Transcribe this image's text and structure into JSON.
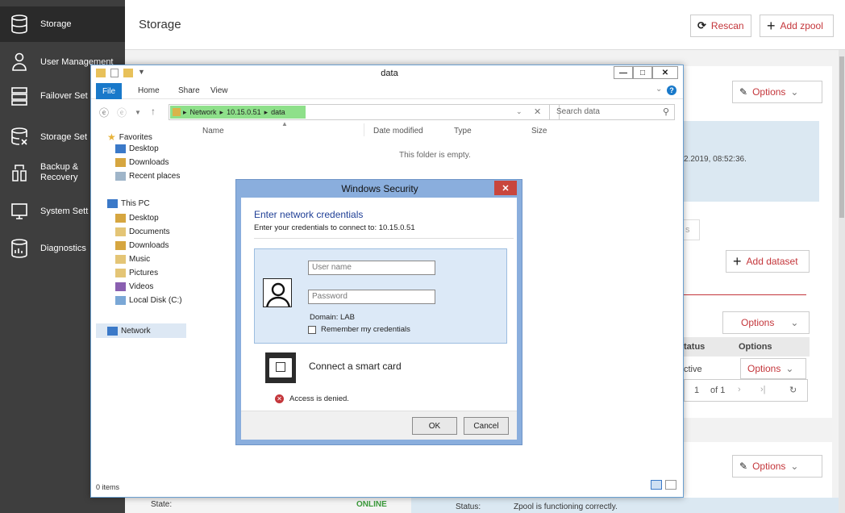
{
  "sidebar": {
    "items": [
      {
        "label": "Storage"
      },
      {
        "label": "User Management"
      },
      {
        "label": "Failover Set"
      },
      {
        "label": "Storage Set"
      },
      {
        "label": "Backup & Recovery"
      },
      {
        "label": "System Sett"
      },
      {
        "label": "Diagnostics"
      }
    ]
  },
  "header": {
    "title": "Storage",
    "rescan": "Rescan",
    "add_zpool": "Add zpool"
  },
  "main": {
    "options": "Options",
    "date_text": "2.2019, 08:52:36.",
    "tab_s": "s",
    "add_dataset": "Add dataset",
    "col_status": "tatus",
    "col_options": "Options",
    "row_status": "ctive",
    "page_num": "1",
    "page_of": "of 1",
    "state_label": "State:",
    "state_value": "ONLINE",
    "status_label": "Status:",
    "status_value": "Zpool is functioning correctly."
  },
  "explorer": {
    "title": "data",
    "tabs": [
      "File",
      "Home",
      "Share",
      "View"
    ],
    "path": [
      "Network",
      "10.15.0.51",
      "data"
    ],
    "search_placeholder": "Search data",
    "columns": [
      "Name",
      "Date modified",
      "Type",
      "Size"
    ],
    "empty_text": "This folder is empty.",
    "favorites_label": "Favorites",
    "favorites": [
      "Desktop",
      "Downloads",
      "Recent places"
    ],
    "thispc_label": "This PC",
    "thispc": [
      "Desktop",
      "Documents",
      "Downloads",
      "Music",
      "Pictures",
      "Videos",
      "Local Disk (C:)"
    ],
    "network_label": "Network",
    "status": "0 items"
  },
  "security": {
    "title": "Windows Security",
    "heading": "Enter network credentials",
    "subheading": "Enter your credentials to connect to: 10.15.0.51",
    "username_placeholder": "User name",
    "password_placeholder": "Password",
    "domain": "Domain: LAB",
    "remember": "Remember my credentials",
    "smartcard": "Connect a smart card",
    "error": "Access is denied.",
    "ok": "OK",
    "cancel": "Cancel"
  },
  "colors": {
    "accent": "#c4363b",
    "sidebar": "#3e3e3e",
    "win_blue": "#1979ca",
    "state_green": "#3a9a3a"
  }
}
